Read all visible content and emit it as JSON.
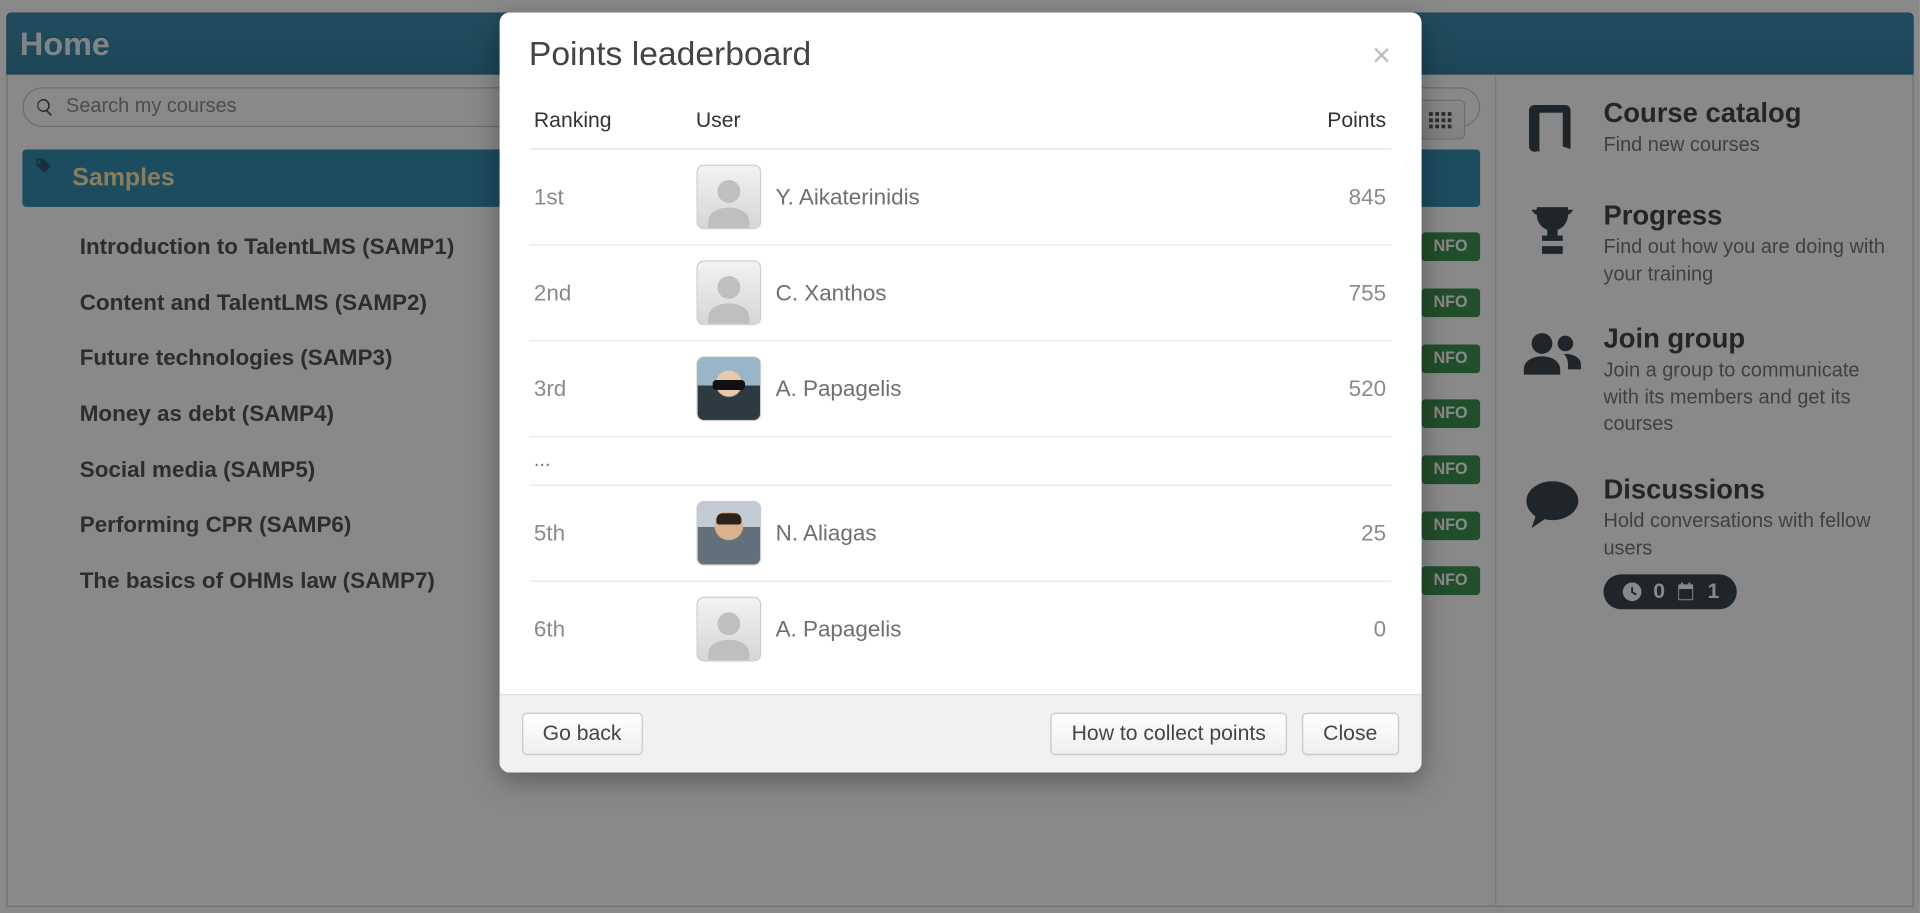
{
  "header": {
    "title": "Home"
  },
  "search": {
    "placeholder": "Search my courses"
  },
  "category": {
    "name": "Samples"
  },
  "courses": [
    {
      "title": "Introduction to TalentLMS (SAMP1)",
      "info": "NFO"
    },
    {
      "title": "Content and TalentLMS (SAMP2)",
      "info": "NFO"
    },
    {
      "title": "Future technologies (SAMP3)",
      "info": "NFO"
    },
    {
      "title": "Money as debt (SAMP4)",
      "info": "NFO"
    },
    {
      "title": "Social media (SAMP5)",
      "info": "NFO"
    },
    {
      "title": "Performing CPR (SAMP6)",
      "info": "NFO"
    },
    {
      "title": "The basics of OHMs law (SAMP7)",
      "info": "NFO"
    }
  ],
  "sidebar": {
    "catalog": {
      "title": "Course catalog",
      "desc": "Find new courses"
    },
    "progress": {
      "title": "Progress",
      "desc": "Find out how you are doing with your training"
    },
    "joingroup": {
      "title": "Join group",
      "desc": "Join a group to communicate with its members and get its courses"
    },
    "discussions": {
      "title": "Discussions",
      "desc": "Hold conversations with fellow users",
      "clock_count": "0",
      "cal_count": "1"
    }
  },
  "modal": {
    "title": "Points leaderboard",
    "columns": {
      "rank": "Ranking",
      "user": "User",
      "points": "Points"
    },
    "rows": [
      {
        "rank": "1st",
        "user": "Y. Aikaterinidis",
        "points": "845",
        "avatar": "silhouette"
      },
      {
        "rank": "2nd",
        "user": "C. Xanthos",
        "points": "755",
        "avatar": "silhouette"
      },
      {
        "rank": "3rd",
        "user": "A. Papagelis",
        "points": "520",
        "avatar": "photo-a"
      },
      {
        "rank": "5th",
        "user": "N. Aliagas",
        "points": "25",
        "avatar": "photo-b"
      },
      {
        "rank": "6th",
        "user": "A. Papagelis",
        "points": "0",
        "avatar": "silhouette"
      }
    ],
    "ellipsis": "...",
    "buttons": {
      "back": "Go back",
      "howto": "How to collect points",
      "close": "Close"
    }
  }
}
